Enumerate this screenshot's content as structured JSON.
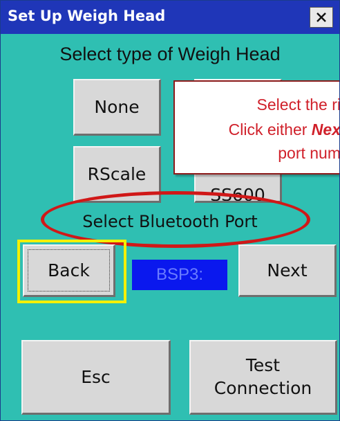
{
  "window": {
    "title": "Set Up Weigh Head",
    "close_label": "×"
  },
  "heading": "Select type of Weigh Head",
  "weigh_head_buttons": {
    "none": "None",
    "rscale": "RScale",
    "partially_hidden": "SS600"
  },
  "callout": {
    "line1": "Select the ri",
    "line2_prefix": "Click either ",
    "line2_bold": "Nex",
    "line3": "port num"
  },
  "bluetooth_label": "Select Bluetooth Port",
  "port_value": "BSP3:",
  "nav": {
    "back": "Back",
    "next": "Next"
  },
  "bottom": {
    "esc": "Esc",
    "test_line1": "Test",
    "test_line2": "Connection"
  },
  "colors": {
    "background": "#2fbfb2",
    "titlebar": "#1f36b8",
    "port_box": "#0a18ee",
    "highlight_ellipse": "#d01818",
    "focus_highlight": "#f4f000",
    "callout_text": "#d0202a"
  }
}
